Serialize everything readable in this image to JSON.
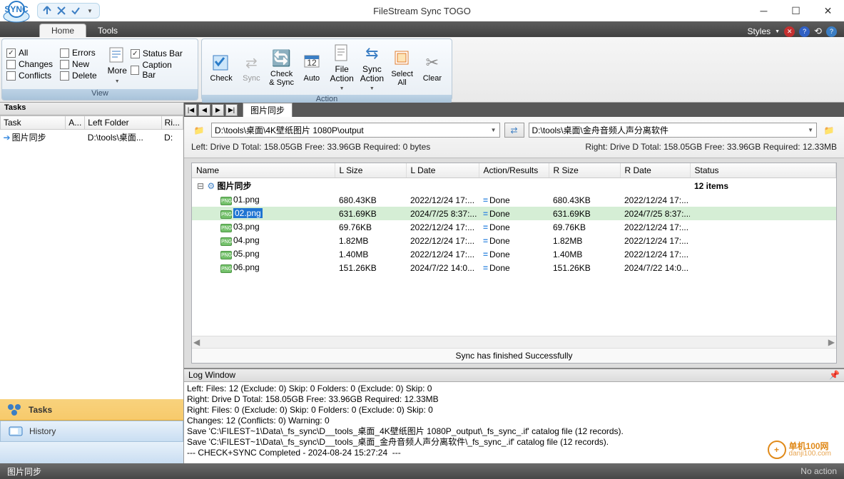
{
  "app": {
    "title": "FileStream Sync TOGO"
  },
  "tabs": {
    "home": "Home",
    "tools": "Tools",
    "styles": "Styles"
  },
  "ribbon": {
    "view": {
      "caption": "View",
      "all": "All",
      "errors": "Errors",
      "status_bar": "Status Bar",
      "changes": "Changes",
      "new": "New",
      "caption_bar": "Caption Bar",
      "conflicts": "Conflicts",
      "delete": "Delete",
      "more": "More"
    },
    "action": {
      "caption": "Action",
      "check": "Check",
      "sync": "Sync",
      "check_sync": "Check\n& Sync",
      "auto": "Auto",
      "file_action": "File\nAction",
      "sync_action": "Sync\nAction",
      "select_all": "Select\nAll",
      "clear": "Clear"
    }
  },
  "tasks": {
    "header": "Tasks",
    "cols": {
      "task": "Task",
      "a": "A...",
      "left": "Left Folder",
      "right": "Ri..."
    },
    "row": {
      "name": "图片同步",
      "left": "D:\\tools\\桌面...",
      "right": "D:"
    }
  },
  "nav": {
    "tasks": "Tasks",
    "history": "History"
  },
  "file_tab": "图片同步",
  "paths": {
    "left": "D:\\tools\\桌面\\4K壁纸图片 1080P\\output",
    "right": "D:\\tools\\桌面\\金舟音频人声分离软件"
  },
  "drive": {
    "left": "Left: Drive D Total: 158.05GB Free: 33.96GB Required: 0 bytes",
    "right": "Right: Drive D Total: 158.05GB Free: 33.96GB Required: 12.33MB"
  },
  "grid": {
    "cols": {
      "name": "Name",
      "lsize": "L Size",
      "ldate": "L Date",
      "action": "Action/Results",
      "rsize": "R Size",
      "rdate": "R Date",
      "status": "Status"
    },
    "root": "图片同步",
    "root_status": "12 items",
    "rows": [
      {
        "name": "01.png",
        "lsize": "680.43KB",
        "ldate": "2022/12/24 17:...",
        "action": "Done",
        "rsize": "680.43KB",
        "rdate": "2022/12/24 17:..."
      },
      {
        "name": "02.png",
        "lsize": "631.69KB",
        "ldate": "2024/7/25 8:37:...",
        "action": "Done",
        "rsize": "631.69KB",
        "rdate": "2024/7/25 8:37:...",
        "sel": true
      },
      {
        "name": "03.png",
        "lsize": "69.76KB",
        "ldate": "2022/12/24 17:...",
        "action": "Done",
        "rsize": "69.76KB",
        "rdate": "2022/12/24 17:..."
      },
      {
        "name": "04.png",
        "lsize": "1.82MB",
        "ldate": "2022/12/24 17:...",
        "action": "Done",
        "rsize": "1.82MB",
        "rdate": "2022/12/24 17:..."
      },
      {
        "name": "05.png",
        "lsize": "1.40MB",
        "ldate": "2022/12/24 17:...",
        "action": "Done",
        "rsize": "1.40MB",
        "rdate": "2022/12/24 17:..."
      },
      {
        "name": "06.png",
        "lsize": "151.26KB",
        "ldate": "2024/7/22 14:0...",
        "action": "Done",
        "rsize": "151.26KB",
        "rdate": "2024/7/22 14:0..."
      }
    ],
    "sync_msg": "Sync has finished Successfully"
  },
  "log": {
    "header": "Log Window",
    "lines": "Left: Files: 12 (Exclude: 0) Skip: 0 Folders: 0 (Exclude: 0) Skip: 0\nRight: Drive D Total: 158.05GB Free: 33.96GB Required: 12.33MB\nRight: Files: 0 (Exclude: 0) Skip: 0 Folders: 0 (Exclude: 0) Skip: 0\nChanges: 12 (Conflicts: 0) Warning: 0\nSave 'C:\\FILEST~1\\Data\\_fs_sync\\D__tools_桌面_4K壁纸图片 1080P_output\\_fs_sync_.if' catalog file (12 records).\nSave 'C:\\FILEST~1\\Data\\_fs_sync\\D__tools_桌面_金舟音频人声分离软件\\_fs_sync_.if' catalog file (12 records).\n--- CHECK+SYNC Completed - 2024-08-24 15:27:24  ---"
  },
  "status": {
    "left": "图片同步",
    "right": "No action"
  },
  "watermark": {
    "brand": "单机100网",
    "url": "danji100.com"
  }
}
